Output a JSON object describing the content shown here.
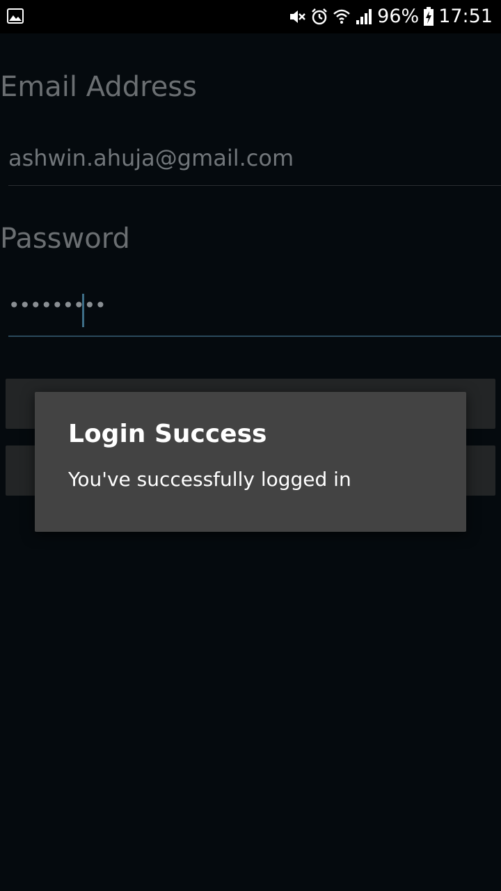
{
  "status_bar": {
    "left_icon": "image-notification-icon",
    "icons": [
      "mute-icon",
      "alarm-icon",
      "wifi-icon",
      "signal-icon"
    ],
    "battery": "96%",
    "battery_icon": "battery-charging-icon",
    "time": "17:51"
  },
  "form": {
    "email_label": "Email Address",
    "email_value": "ashwin.ahuja@gmail.com",
    "password_label": "Password",
    "password_value": "•••••••••"
  },
  "dialog": {
    "title": "Login Success",
    "message": "You've successfully logged in"
  },
  "colors": {
    "background": "#050a0e",
    "dialog_bg": "#434343",
    "accent": "#3d6d86"
  }
}
